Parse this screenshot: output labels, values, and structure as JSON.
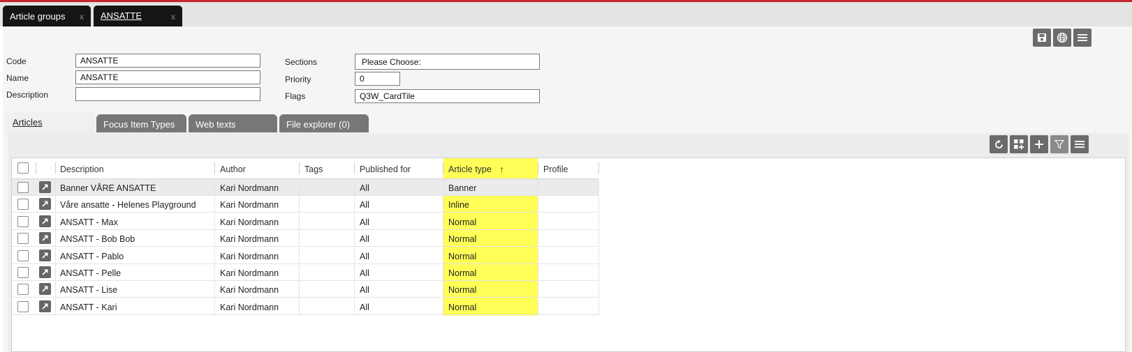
{
  "tabs": [
    {
      "label": "Article groups",
      "close": "x"
    },
    {
      "label": "ANSATTE",
      "close": "x"
    }
  ],
  "form": {
    "code_label": "Code",
    "code_value": "ANSATTE",
    "name_label": "Name",
    "name_value": "ANSATTE",
    "description_label": "Description",
    "description_value": "",
    "sections_label": "Sections",
    "sections_value": "Please Choose:",
    "priority_label": "Priority",
    "priority_value": "0",
    "flags_label": "Flags",
    "flags_value": "Q3W_CardTile"
  },
  "subtabs": [
    "Articles",
    "Focus Item Types",
    "Web texts",
    "File explorer (0)"
  ],
  "grid": {
    "columns": {
      "description": "Description",
      "author": "Author",
      "tags": "Tags",
      "published": "Published for",
      "article_type": "Article type",
      "sort_arrow": "↑",
      "profile": "Profile"
    },
    "rows": [
      {
        "description": "Banner VÅRE ANSATTE",
        "author": "Kari Nordmann",
        "tags": "",
        "published": "All",
        "type": "Banner",
        "profile": ""
      },
      {
        "description": "Våre ansatte - Helenes Playground",
        "author": "Kari Nordmann",
        "tags": "",
        "published": "All",
        "type": "Inline",
        "profile": ""
      },
      {
        "description": "ANSATT - Max",
        "author": "Kari Nordmann",
        "tags": "",
        "published": "All",
        "type": "Normal",
        "profile": ""
      },
      {
        "description": "ANSATT - Bob Bob",
        "author": "Kari Nordmann",
        "tags": "",
        "published": "All",
        "type": "Normal",
        "profile": ""
      },
      {
        "description": "ANSATT - Pablo",
        "author": "Kari Nordmann",
        "tags": "",
        "published": "All",
        "type": "Normal",
        "profile": ""
      },
      {
        "description": "ANSATT - Pelle",
        "author": "Kari Nordmann",
        "tags": "",
        "published": "All",
        "type": "Normal",
        "profile": ""
      },
      {
        "description": "ANSATT - Lise",
        "author": "Kari Nordmann",
        "tags": "",
        "published": "All",
        "type": "Normal",
        "profile": ""
      },
      {
        "description": "ANSATT - Kari",
        "author": "Kari Nordmann",
        "tags": "",
        "published": "All",
        "type": "Normal",
        "profile": ""
      }
    ]
  },
  "colors": {
    "accent_red": "#c0282d",
    "highlight_yellow": "#ffff4a",
    "tab_dark": "#151515",
    "button_grey": "#6b6b6b"
  },
  "icons": [
    "save-icon",
    "globe-icon",
    "menu-icon",
    "refresh-icon",
    "add-grid-icon",
    "plus-icon",
    "filter-icon",
    "grid-menu-icon",
    "open-link-icon"
  ]
}
